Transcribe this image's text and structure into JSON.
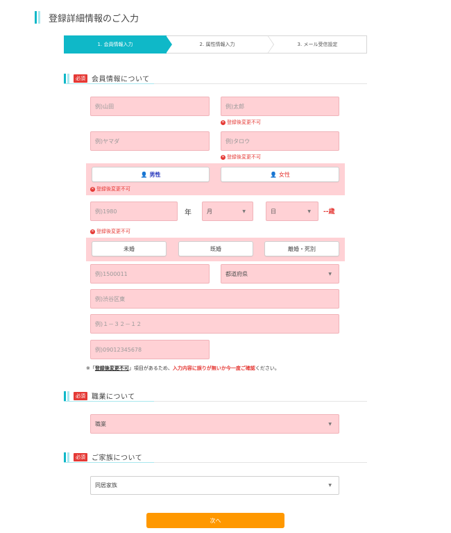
{
  "header": {
    "title": "登録詳細情報のご入力"
  },
  "steps": [
    {
      "label": "1. 会員情報入力"
    },
    {
      "label": "2. 属性情報入力"
    },
    {
      "label": "3. メール受信設定"
    }
  ],
  "sections": {
    "member": {
      "badge": "必須",
      "title": "会員情報について"
    },
    "job": {
      "badge": "必須",
      "title": "職業について"
    },
    "family": {
      "badge": "必須",
      "title": "ご家族について"
    }
  },
  "member": {
    "last_name_placeholder": "例)山田",
    "first_name_placeholder": "例)太郎",
    "last_kana_placeholder": "例)ヤマダ",
    "first_kana_placeholder": "例)タロウ",
    "unchangeable_note": "登録後変更不可",
    "gender_male": "男性",
    "gender_female": "女性",
    "birth_year_placeholder": "例)1980",
    "year_char": "年",
    "month_select": "月",
    "day_select": "日",
    "age_text": "--歳",
    "marital": [
      "未婚",
      "既婚",
      "離婚・死別"
    ],
    "zip_placeholder": "例)1500011",
    "prefecture_select": "都道府県",
    "address1_placeholder": "例)渋谷区東",
    "address2_placeholder": "例)１－３２－１２",
    "phone_placeholder": "例)09012345678"
  },
  "notice": {
    "prefix": "※「",
    "strong": "登録後変更不可",
    "middle": "」項目があるため、",
    "red": "入力内容に誤りが無いか今一度ご確認",
    "suffix": "ください。"
  },
  "job": {
    "select": "職業"
  },
  "family": {
    "select": "同居家族"
  },
  "next_button": "次へ",
  "colors": {
    "accent": "#0fb8c8",
    "error_fill": "#ffd1d5",
    "required": "#e53935",
    "next": "#ff9800"
  }
}
